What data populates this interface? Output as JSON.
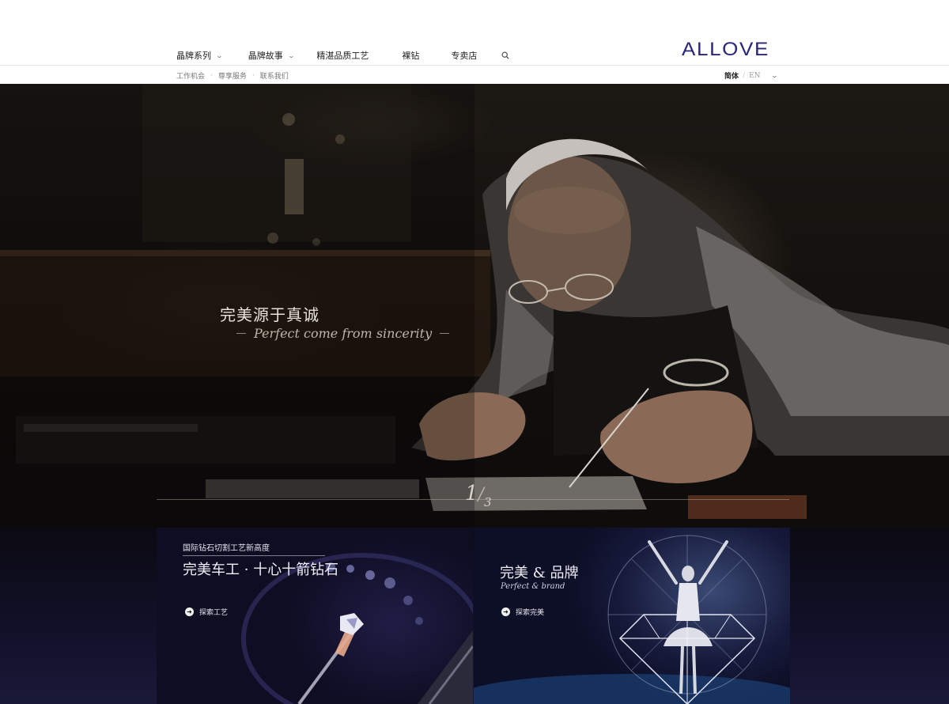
{
  "header": {
    "nav": [
      {
        "label": "晶牌系列",
        "dropdown": true
      },
      {
        "label": "晶牌故事",
        "dropdown": true
      },
      {
        "label": "精湛品质工艺",
        "dropdown": false
      },
      {
        "label": "裸钻",
        "dropdown": false
      },
      {
        "label": "专卖店",
        "dropdown": false
      }
    ],
    "search_icon": "search-icon",
    "logo_text": "ALLOVE",
    "logo_color": "#2a2577"
  },
  "subbar": {
    "links": [
      "工作机会",
      "尊享服务",
      "联系我们"
    ],
    "lang_active": "简体",
    "lang_other": "EN"
  },
  "hero": {
    "title": "完美源于真诚",
    "subtitle": "Perfect come from sincerity",
    "slide_current": "1",
    "slide_total": "3"
  },
  "cards": [
    {
      "kicker": "国际钻石切割工艺新高度",
      "title": "完美车工 · 十心十箭钻石",
      "cta": "探索工艺"
    },
    {
      "title": "完美 & 品牌",
      "subtitle": "Perfect & brand",
      "cta": "探索完美"
    }
  ]
}
